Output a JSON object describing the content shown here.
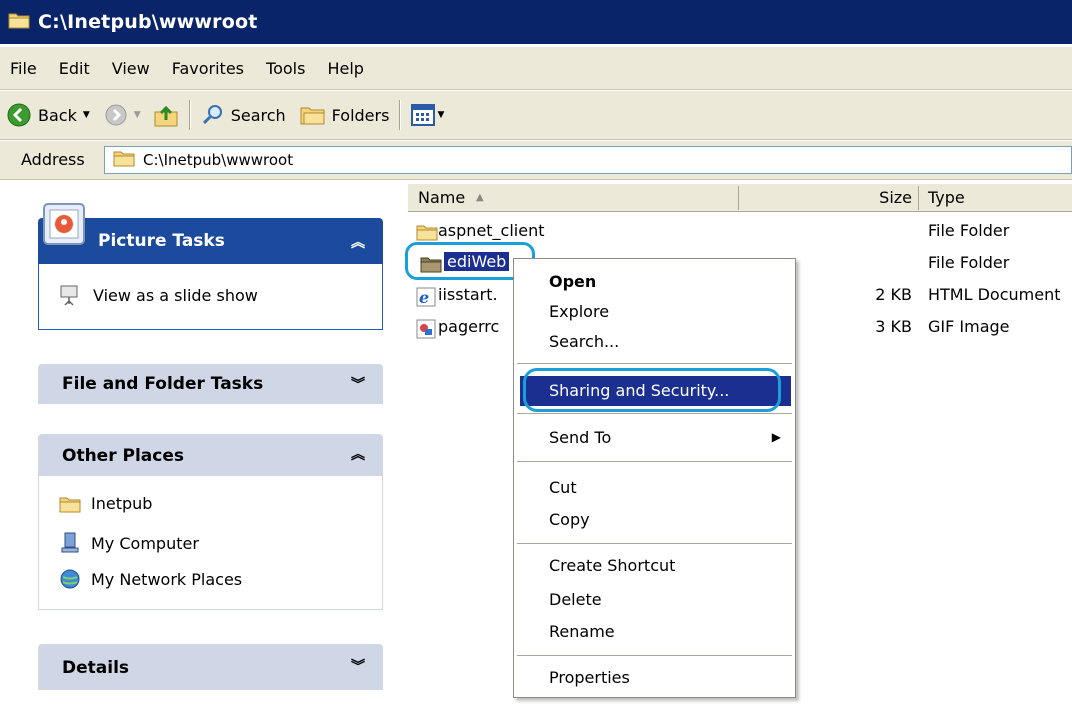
{
  "window": {
    "title": "C:\\Inetpub\\wwwroot"
  },
  "menu": {
    "file": "File",
    "edit": "Edit",
    "view": "View",
    "favorites": "Favorites",
    "tools": "Tools",
    "help": "Help"
  },
  "toolbar": {
    "back": "Back",
    "search": "Search",
    "folders": "Folders"
  },
  "address": {
    "label": "Address",
    "value": "C:\\Inetpub\\wwwroot"
  },
  "tasks": {
    "picture": {
      "title": "Picture Tasks",
      "items": [
        "View as a slide show"
      ]
    },
    "file_folder": {
      "title": "File and Folder Tasks"
    },
    "other_places": {
      "title": "Other Places",
      "items": [
        "Inetpub",
        "My Computer",
        "My Network Places"
      ]
    },
    "details": {
      "title": "Details"
    }
  },
  "columns": {
    "name": "Name",
    "size": "Size",
    "type": "Type"
  },
  "files": [
    {
      "name": "aspnet_client",
      "size": "",
      "type": "File Folder"
    },
    {
      "name": "ediWeb",
      "size": "",
      "type": "File Folder"
    },
    {
      "name": "iisstart.",
      "size": "2 KB",
      "type": "HTML Document"
    },
    {
      "name": "pagerrc",
      "size": "3 KB",
      "type": "GIF Image"
    }
  ],
  "context_menu": {
    "open": "Open",
    "explore": "Explore",
    "search": "Search...",
    "sharing": "Sharing and Security...",
    "send_to": "Send To",
    "cut": "Cut",
    "copy": "Copy",
    "create_shortcut": "Create Shortcut",
    "delete": "Delete",
    "rename": "Rename",
    "properties": "Properties"
  },
  "colors": {
    "titlebar": "#0a246a",
    "selection": "#1a2f8f",
    "highlight_ring": "#1a9fdb",
    "taskpane_header": "#cfd6e6"
  }
}
